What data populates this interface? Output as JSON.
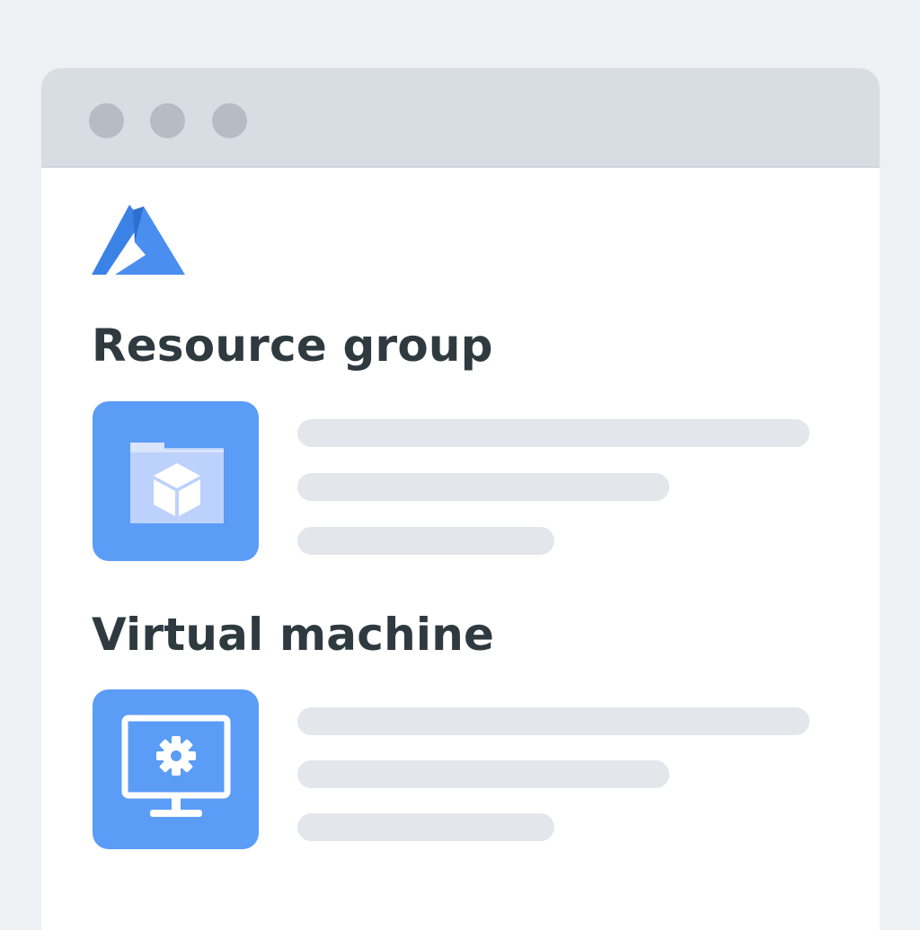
{
  "window": {
    "controls": [
      "window-dot",
      "window-dot",
      "window-dot"
    ]
  },
  "logo": {
    "icon": "azure-logo-icon",
    "color": "#3b82e6"
  },
  "sections": [
    {
      "heading": "Resource group",
      "icon": "resource-group-icon"
    },
    {
      "heading": "Virtual machine",
      "icon": "virtual-machine-icon"
    }
  ],
  "colors": {
    "background": "#eef1f4",
    "titlebar": "#d8dde3",
    "tile": "#5b9cf6",
    "placeholder": "#e3e6ea",
    "heading": "#2f3a40"
  }
}
